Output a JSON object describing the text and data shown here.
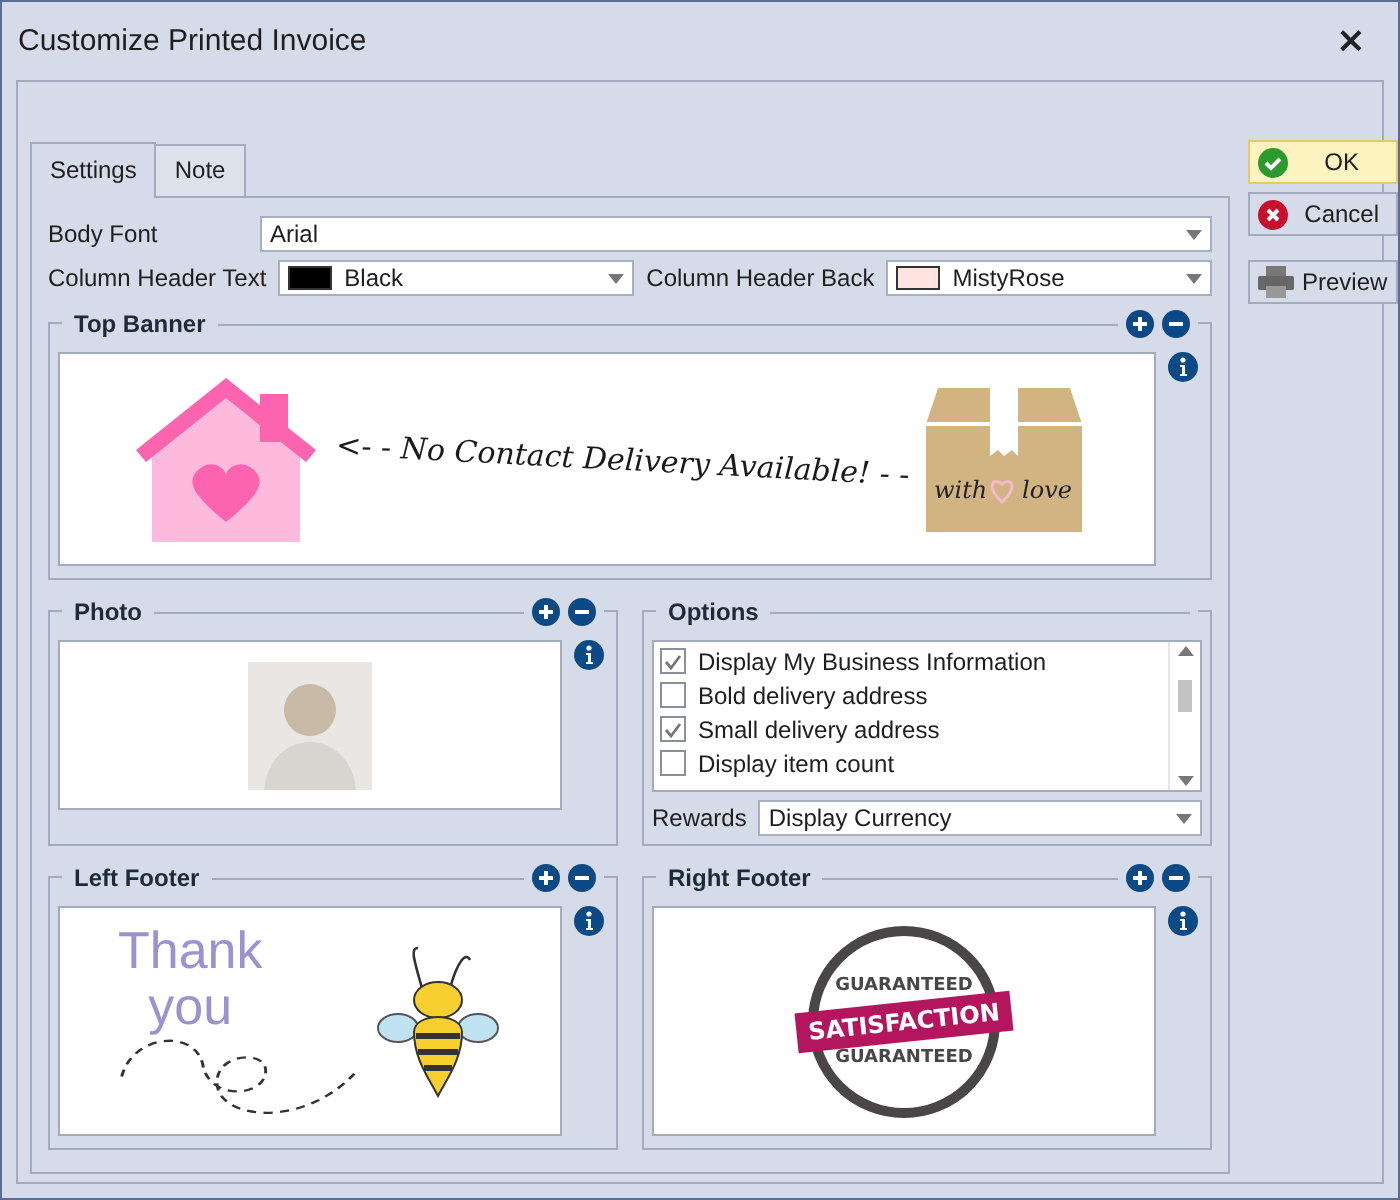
{
  "window": {
    "title": "Customize Printed Invoice",
    "close": "×"
  },
  "tabs": [
    {
      "label": "Settings",
      "selected": true
    },
    {
      "label": "Note",
      "selected": false
    }
  ],
  "body_font": {
    "label": "Body Font",
    "value": "Arial"
  },
  "column_header_text": {
    "label": "Column Header Text",
    "value": "Black",
    "color": "#000000"
  },
  "column_header_back": {
    "label": "Column Header Back",
    "value": "MistyRose",
    "color": "#ffe4e1"
  },
  "top_banner": {
    "title": "Top Banner",
    "image_text": "<- - No Contact Delivery Available! - -",
    "box_text": [
      "with",
      "love"
    ]
  },
  "photo": {
    "title": "Photo"
  },
  "options": {
    "title": "Options",
    "items": [
      {
        "label": "Display My Business Information",
        "checked": true
      },
      {
        "label": "Bold delivery address",
        "checked": false
      },
      {
        "label": "Small delivery address",
        "checked": true
      },
      {
        "label": "Display item count",
        "checked": false
      }
    ],
    "rewards": {
      "label": "Rewards",
      "value": "Display Currency"
    }
  },
  "left_footer": {
    "title": "Left Footer",
    "image_text": [
      "Thank",
      "you"
    ]
  },
  "right_footer": {
    "title": "Right Footer",
    "seal_text": [
      "GUARANTEED",
      "SATISFACTION",
      "GUARANTEED"
    ]
  },
  "buttons": [
    {
      "label": "OK",
      "kind": "ok",
      "selected": true
    },
    {
      "label": "Cancel",
      "kind": "cancel",
      "selected": false
    },
    {
      "label": "Preview",
      "kind": "preview",
      "selected": false
    }
  ]
}
